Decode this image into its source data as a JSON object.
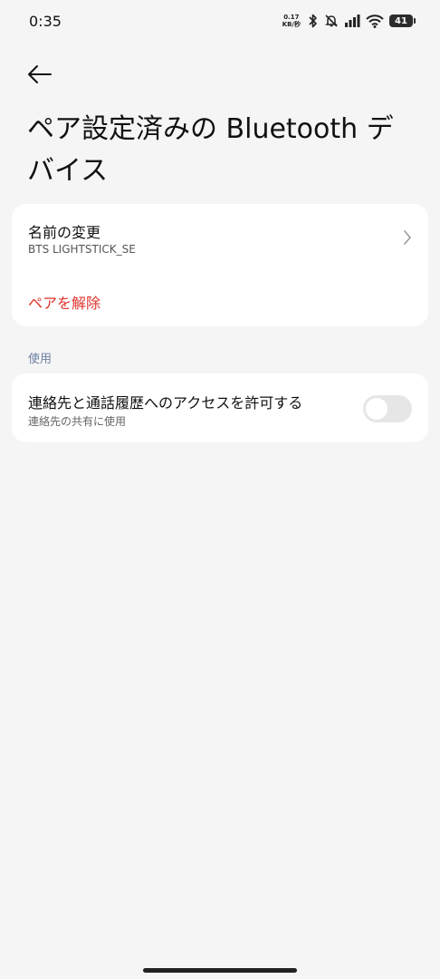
{
  "status_bar": {
    "time": "0:35",
    "speed_value": "0.17",
    "speed_unit": "KB/秒",
    "battery": "41",
    "icons": [
      "bluetooth-icon",
      "bell-off-icon",
      "signal-icon",
      "wifi-icon",
      "battery-icon"
    ]
  },
  "header": {
    "back_icon": "arrow-left-icon",
    "title": "ペア設定済みの Bluetooth デバイス"
  },
  "device_card": {
    "rename_label": "名前の変更",
    "device_name": "BTS LIGHTSTICK_SE",
    "unpair_label": "ペアを解除"
  },
  "usage_section": {
    "label": "使用",
    "contacts_title": "連絡先と通話履歴へのアクセスを許可する",
    "contacts_subtitle": "連絡先の共有に使用",
    "toggle_on": false
  },
  "colors": {
    "background": "#f5f5f5",
    "card": "#ffffff",
    "danger": "#e0322b",
    "section_label": "#6b7fa3",
    "toggle_off": "#e6e6e6"
  }
}
